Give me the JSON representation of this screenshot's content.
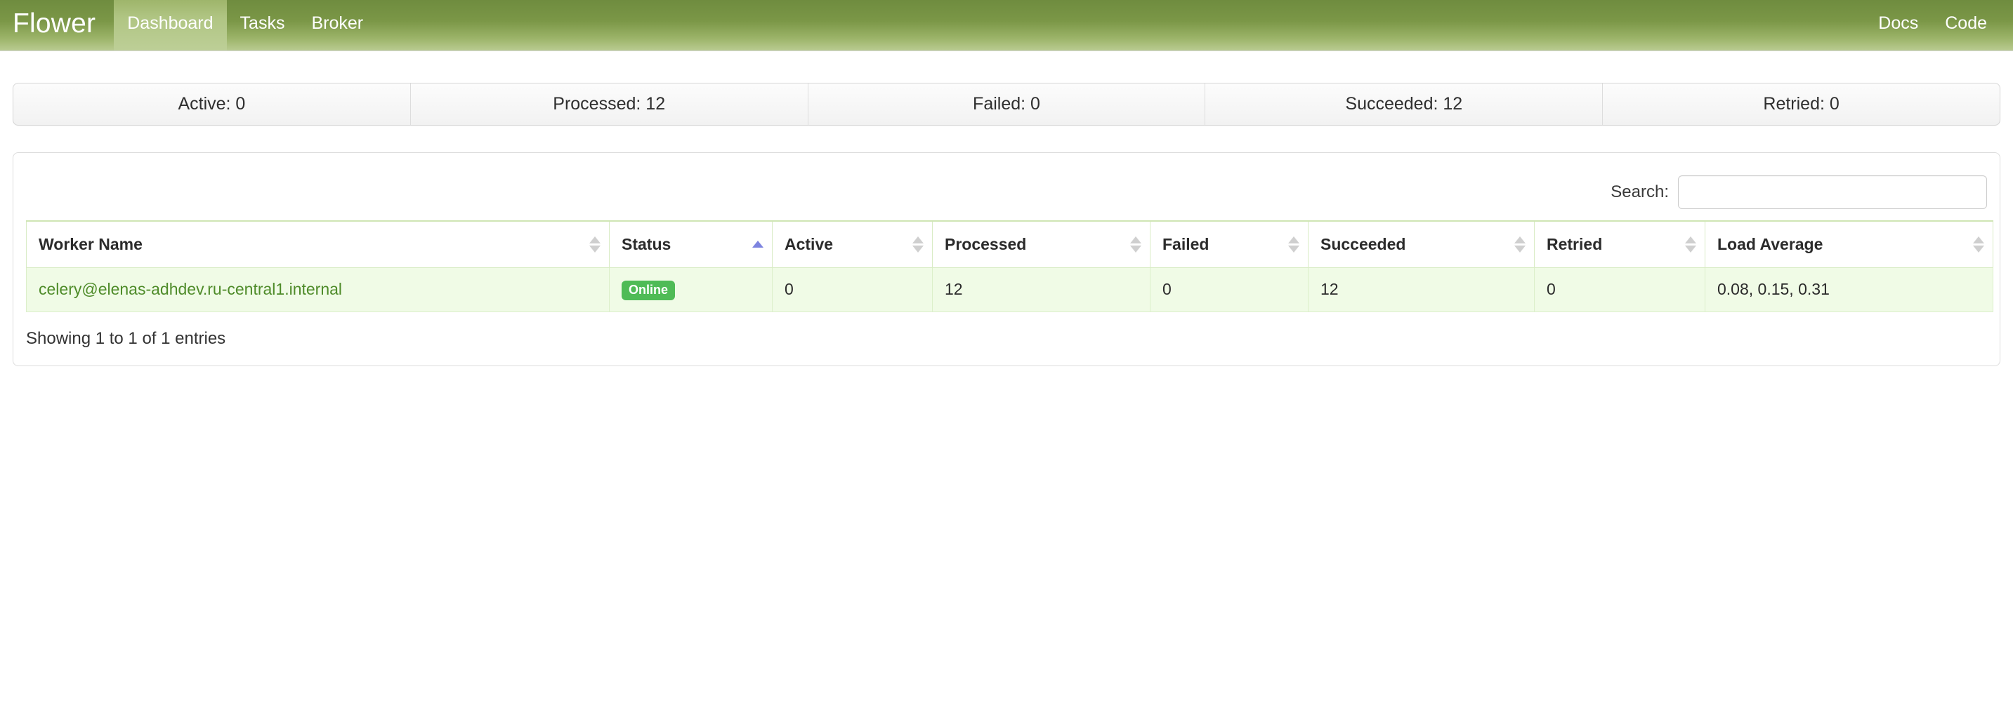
{
  "navbar": {
    "brand": "Flower",
    "links": [
      {
        "label": "Dashboard",
        "active": true
      },
      {
        "label": "Tasks",
        "active": false
      },
      {
        "label": "Broker",
        "active": false
      }
    ],
    "right_links": [
      {
        "label": "Docs"
      },
      {
        "label": "Code"
      }
    ],
    "gradient_top": "#6f8c3f",
    "gradient_bottom": "#b9cb91",
    "active_tab_color": "#b0c583"
  },
  "stats": [
    {
      "label": "Active: 0"
    },
    {
      "label": "Processed: 12"
    },
    {
      "label": "Failed: 0"
    },
    {
      "label": "Succeeded: 12"
    },
    {
      "label": "Retried: 0"
    }
  ],
  "search": {
    "label": "Search:",
    "value": "",
    "placeholder": ""
  },
  "table": {
    "columns": [
      {
        "label": "Worker Name",
        "sort": "none"
      },
      {
        "label": "Status",
        "sort": "asc"
      },
      {
        "label": "Active",
        "sort": "none"
      },
      {
        "label": "Processed",
        "sort": "none"
      },
      {
        "label": "Failed",
        "sort": "none"
      },
      {
        "label": "Succeeded",
        "sort": "none"
      },
      {
        "label": "Retried",
        "sort": "none"
      },
      {
        "label": "Load Average",
        "sort": "none"
      }
    ],
    "rows": [
      {
        "worker_name": "celery@elenas-adhdev.ru-central1.internal",
        "status": "Online",
        "active": "0",
        "processed": "12",
        "failed": "0",
        "succeeded": "12",
        "retried": "0",
        "load_average": "0.08, 0.15, 0.31"
      }
    ],
    "info": "Showing 1 to 1 of 1 entries",
    "row_bg": "#f0fbe6",
    "border_color": "#dcefca",
    "link_color": "#4e8b29",
    "badge_color": "#4fbb56",
    "sort_active_color": "#7d84e0"
  }
}
